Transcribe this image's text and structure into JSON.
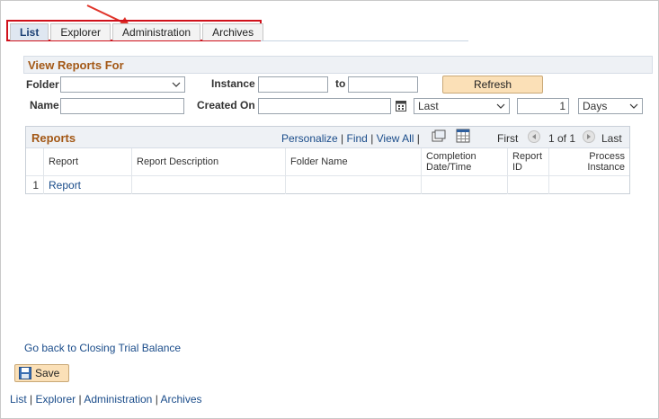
{
  "tabs": [
    {
      "label": "List",
      "active": true
    },
    {
      "label": "Explorer",
      "active": false
    },
    {
      "label": "Administration",
      "active": false
    },
    {
      "label": "Archives",
      "active": false
    }
  ],
  "view_reports": {
    "title": "View Reports For",
    "folder_label": "Folder",
    "folder_value": "",
    "instance_label": "Instance",
    "instance_from": "",
    "to_label": "to",
    "instance_to": "",
    "refresh_label": "Refresh",
    "name_label": "Name",
    "name_value": "",
    "created_on_label": "Created On",
    "created_on_value": "",
    "period_select": "Last",
    "period_count": "1",
    "unit_select": "Days"
  },
  "reports_grid": {
    "title": "Reports",
    "personalize": "Personalize",
    "find": "Find",
    "view_all": "View All",
    "first": "First",
    "pager": "1 of 1",
    "last": "Last",
    "columns": [
      "Report",
      "Report Description",
      "Folder Name",
      "Completion Date/Time",
      "Report ID",
      "Process Instance"
    ],
    "rows": [
      {
        "num": "1",
        "report": "Report",
        "description": "",
        "folder": "",
        "completion": "",
        "report_id": "",
        "process_instance": ""
      }
    ]
  },
  "go_back_link": "Go back to Closing Trial Balance",
  "save_label": "Save",
  "bottom_links": [
    "List",
    "Explorer",
    "Administration",
    "Archives"
  ],
  "colors": {
    "accent_red": "#d0111b",
    "section_title": "#a35816",
    "link": "#1a4c8a",
    "button": "#fbe0b7"
  }
}
